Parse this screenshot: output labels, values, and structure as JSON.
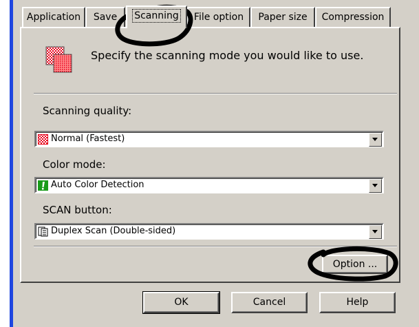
{
  "tabs": [
    {
      "id": "application",
      "label": "Application"
    },
    {
      "id": "save",
      "label": "Save"
    },
    {
      "id": "scanning",
      "label": "Scanning",
      "active": true
    },
    {
      "id": "file_option",
      "label": "File option"
    },
    {
      "id": "paper_size",
      "label": "Paper size"
    },
    {
      "id": "compression",
      "label": "Compression"
    }
  ],
  "header": {
    "icon": "scan-mode-icon",
    "description": "Specify the scanning mode you would like to use."
  },
  "fields": {
    "scanning_quality": {
      "label": "Scanning quality:",
      "value": "Normal (Fastest)",
      "icon": "checker-quality-icon"
    },
    "color_mode": {
      "label": "Color mode:",
      "value": "Auto Color Detection",
      "icon": "auto-color-icon"
    },
    "scan_button": {
      "label": "SCAN button:",
      "value": "Duplex Scan (Double-sided)",
      "icon": "duplex-page-icon"
    }
  },
  "option_button": "Option ...",
  "footer": {
    "ok": "OK",
    "cancel": "Cancel",
    "help": "Help"
  },
  "colors": {
    "dialog_bg": "#d4d0c8",
    "window_edge": "#1f46e0",
    "checker_red": "#e8001c",
    "auto_color_green": "#1a9c1a"
  }
}
